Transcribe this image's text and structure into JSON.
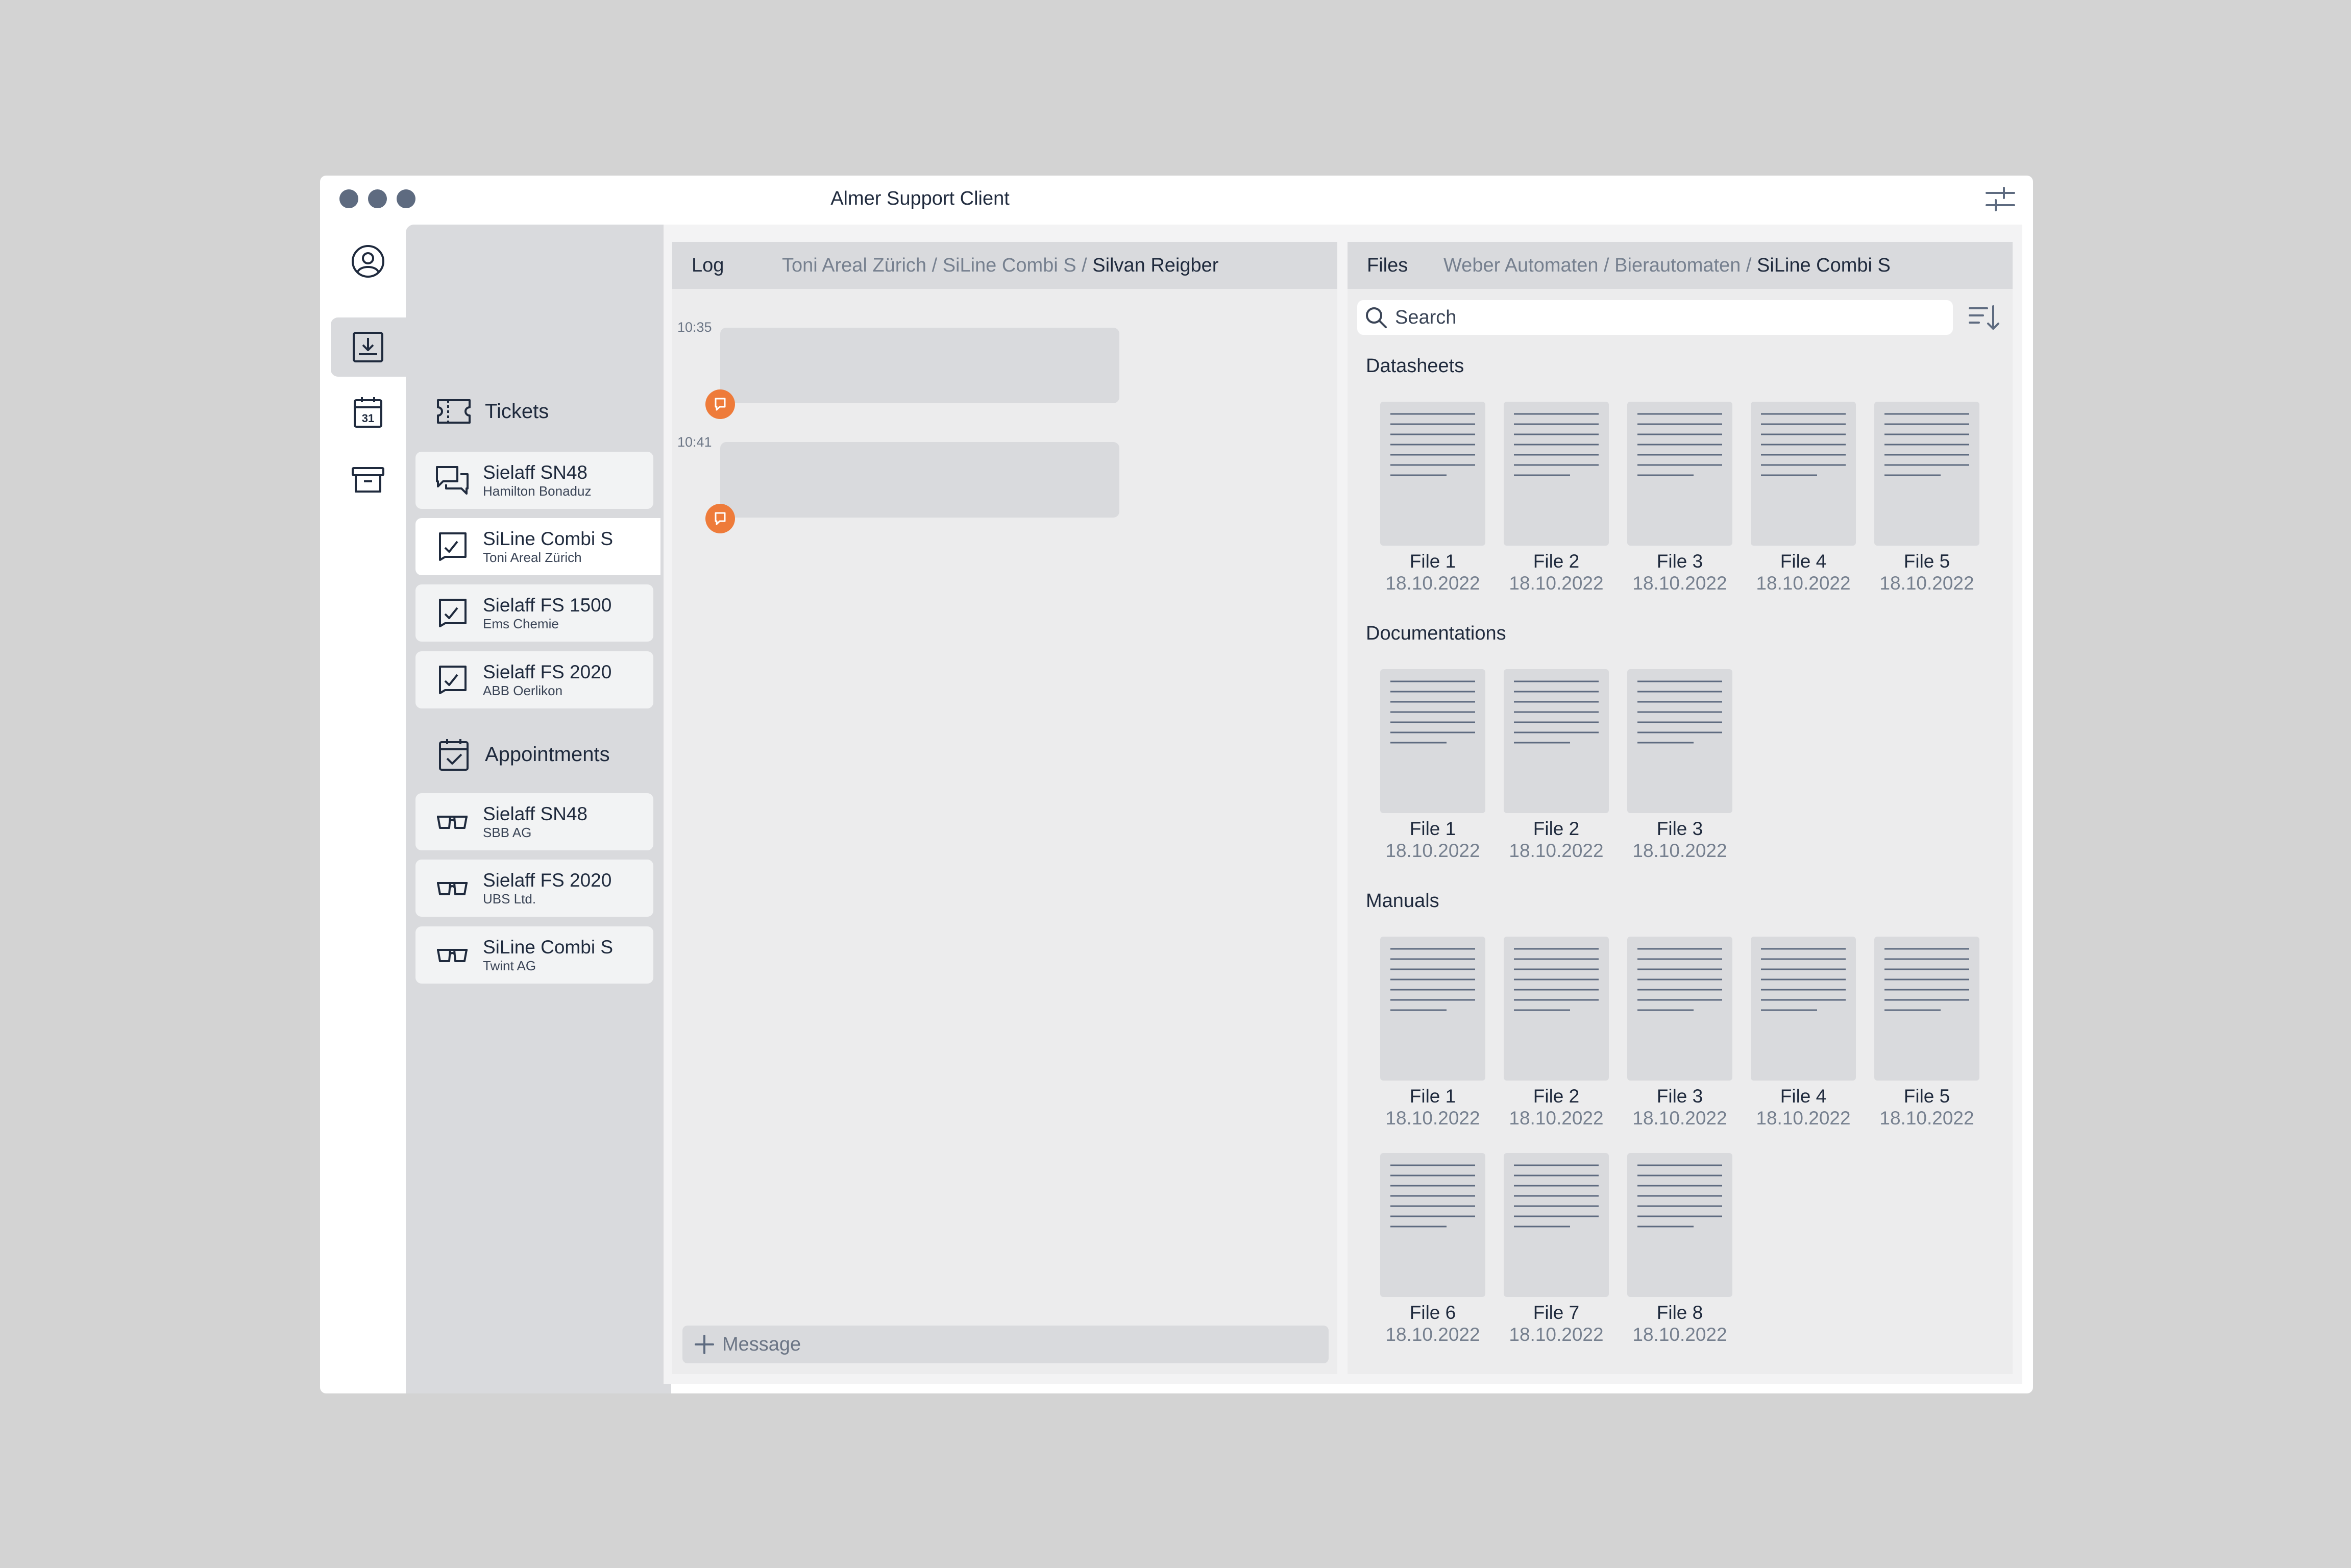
{
  "window": {
    "title": "Almer Support Client"
  },
  "sidebar": {
    "tickets_title": "Tickets",
    "tickets": [
      {
        "title": "Sielaff SN48",
        "subtitle": "Hamilton Bonaduz",
        "icon": "chat-icon"
      },
      {
        "title": "SiLine Combi S",
        "subtitle": "Toni Areal Zürich",
        "icon": "checked-chat-icon"
      },
      {
        "title": "Sielaff FS 1500",
        "subtitle": "Ems Chemie",
        "icon": "checked-chat-icon"
      },
      {
        "title": "Sielaff FS 2020",
        "subtitle": "ABB Oerlikon",
        "icon": "checked-chat-icon"
      }
    ],
    "appointments_title": "Appointments",
    "appointments": [
      {
        "title": "Sielaff SN48",
        "subtitle": "SBB AG",
        "icon": "glasses-icon"
      },
      {
        "title": "Sielaff FS 2020",
        "subtitle": "UBS Ltd.",
        "icon": "glasses-icon"
      },
      {
        "title": "SiLine Combi S",
        "subtitle": "Twint AG",
        "icon": "glasses-icon"
      }
    ]
  },
  "log": {
    "tab": "Log",
    "crumb": {
      "part1": "Toni Areal Zürich / SiLine Combi S / ",
      "current": "Silvan Reigber"
    },
    "messages": [
      {
        "time": "10:35"
      },
      {
        "time": "10:41"
      }
    ],
    "message_placeholder": "Message"
  },
  "files": {
    "tab": "Files",
    "crumb": {
      "part1": "Weber Automaten / Bierautomaten / ",
      "current": "SiLine Combi S"
    },
    "search_placeholder": "Search",
    "datasheets": {
      "title": "Datasheets",
      "items": [
        {
          "name": "File 1",
          "date": "18.10.2022"
        },
        {
          "name": "File 2",
          "date": "18.10.2022"
        },
        {
          "name": "File 3",
          "date": "18.10.2022"
        },
        {
          "name": "File 4",
          "date": "18.10.2022"
        },
        {
          "name": "File 5",
          "date": "18.10.2022"
        }
      ]
    },
    "documentations": {
      "title": "Documentations",
      "items": [
        {
          "name": "File 1",
          "date": "18.10.2022"
        },
        {
          "name": "File 2",
          "date": "18.10.2022"
        },
        {
          "name": "File 3",
          "date": "18.10.2022"
        }
      ]
    },
    "manuals": {
      "title": "Manuals",
      "items": [
        {
          "name": "File 1",
          "date": "18.10.2022"
        },
        {
          "name": "File 2",
          "date": "18.10.2022"
        },
        {
          "name": "File 3",
          "date": "18.10.2022"
        },
        {
          "name": "File 4",
          "date": "18.10.2022"
        },
        {
          "name": "File 5",
          "date": "18.10.2022"
        },
        {
          "name": "File 6",
          "date": "18.10.2022"
        },
        {
          "name": "File 7",
          "date": "18.10.2022"
        },
        {
          "name": "File 8",
          "date": "18.10.2022"
        }
      ]
    }
  },
  "colors": {
    "background": "#d3d3d3",
    "panel": "#d9dadd",
    "text": "#1f2a3d",
    "muted": "#76808f",
    "accent": "#ee7b3a"
  }
}
